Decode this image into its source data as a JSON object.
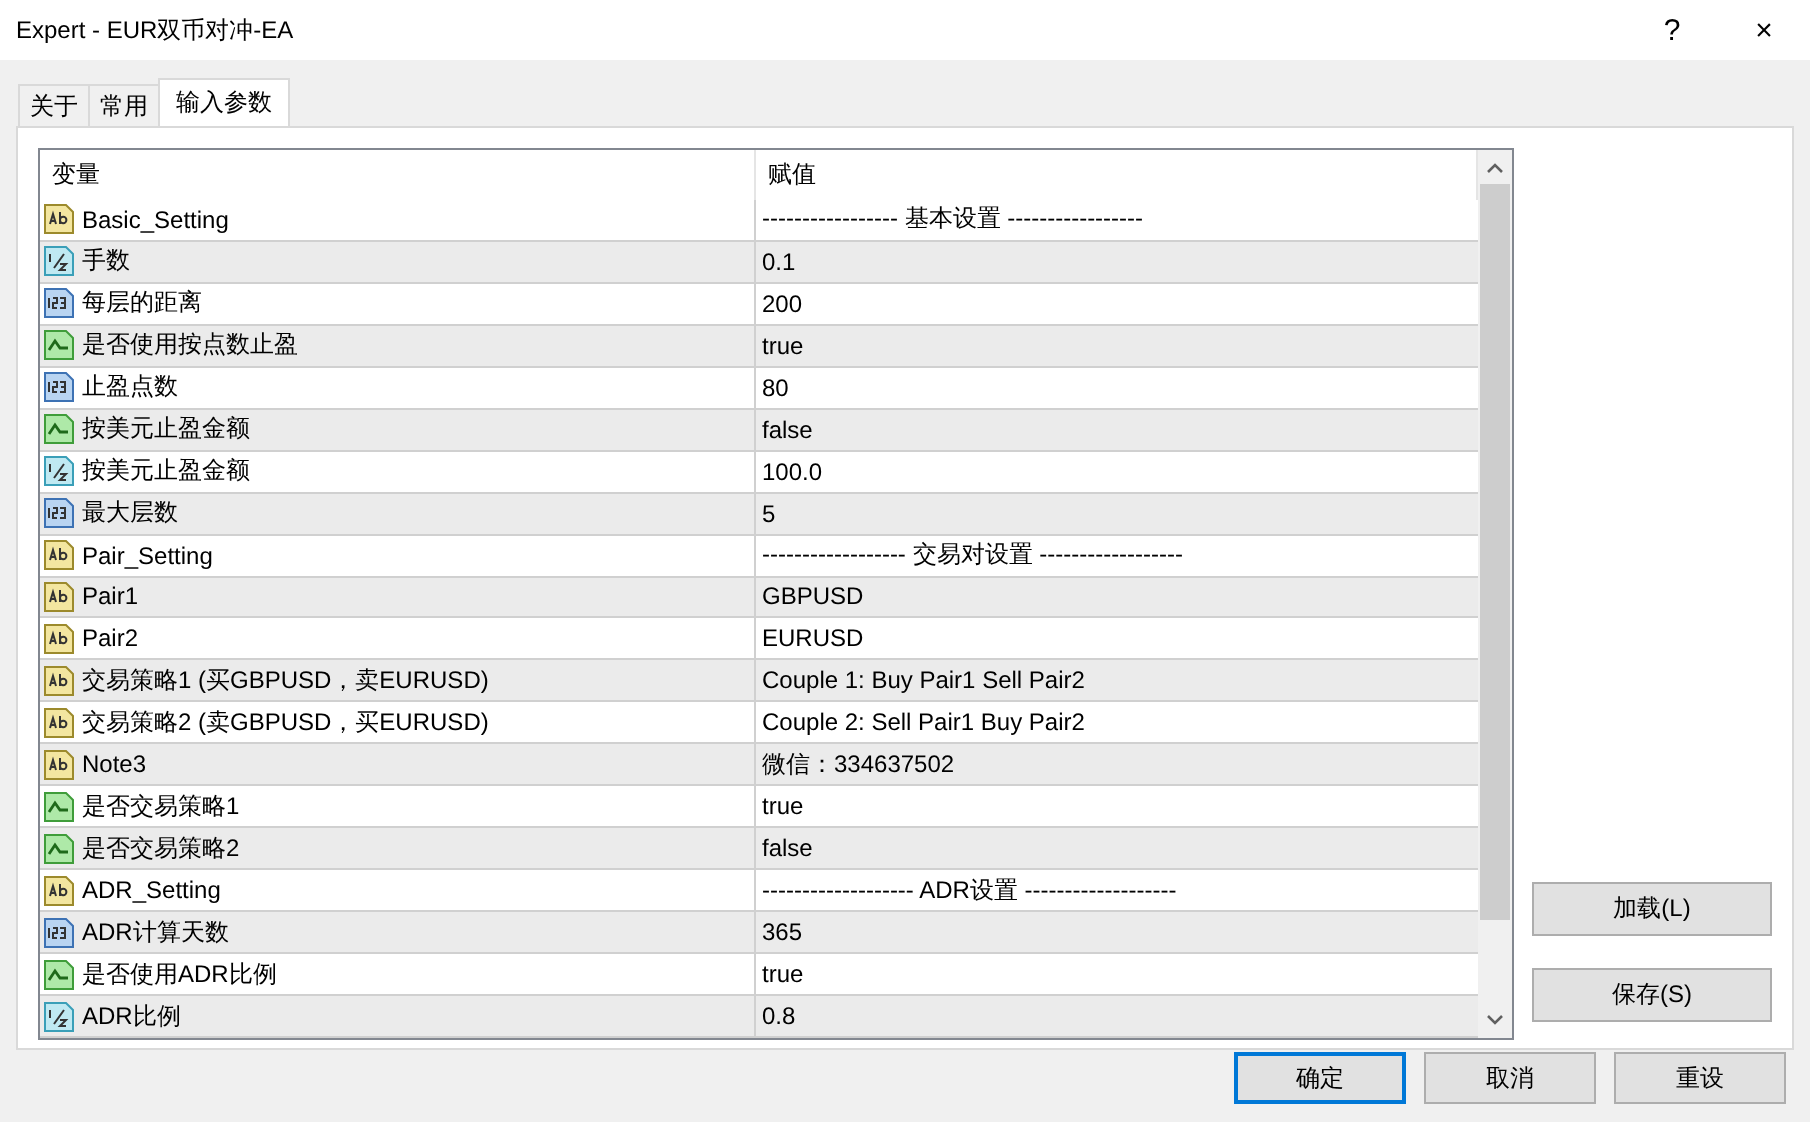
{
  "window": {
    "title": "Expert - EUR双币对冲-EA",
    "help": "?",
    "close": "×"
  },
  "tabs": [
    {
      "label": "关于",
      "selected": false
    },
    {
      "label": "常用",
      "selected": false
    },
    {
      "label": "输入参数",
      "selected": true
    }
  ],
  "table": {
    "columns": [
      "变量",
      "赋值"
    ],
    "rows": [
      {
        "kind": "string",
        "name": "Basic_Setting",
        "value": "----------------- 基本设置 -----------------"
      },
      {
        "kind": "double",
        "name": "手数",
        "value": "0.1"
      },
      {
        "kind": "int",
        "name": "每层的距离",
        "value": "200"
      },
      {
        "kind": "bool",
        "name": "是否使用按点数止盈",
        "value": "true"
      },
      {
        "kind": "int",
        "name": "止盈点数",
        "value": "80"
      },
      {
        "kind": "bool",
        "name": "按美元止盈金额",
        "value": "false"
      },
      {
        "kind": "double",
        "name": "按美元止盈金额",
        "value": "100.0"
      },
      {
        "kind": "int",
        "name": "最大层数",
        "value": "5"
      },
      {
        "kind": "string",
        "name": "Pair_Setting",
        "value": "------------------ 交易对设置 ------------------"
      },
      {
        "kind": "string",
        "name": "Pair1",
        "value": "GBPUSD"
      },
      {
        "kind": "string",
        "name": "Pair2",
        "value": "EURUSD"
      },
      {
        "kind": "string",
        "name": "交易策略1 (买GBPUSD，卖EURUSD)",
        "value": "Couple 1: Buy Pair1 Sell Pair2"
      },
      {
        "kind": "string",
        "name": "交易策略2 (卖GBPUSD，买EURUSD)",
        "value": "Couple 2: Sell Pair1 Buy Pair2"
      },
      {
        "kind": "string",
        "name": "Note3",
        "value": "微信：334637502"
      },
      {
        "kind": "bool",
        "name": "是否交易策略1",
        "value": "true"
      },
      {
        "kind": "bool",
        "name": "是否交易策略2",
        "value": "false"
      },
      {
        "kind": "string",
        "name": "ADR_Setting",
        "value": "------------------- ADR设置 -------------------"
      },
      {
        "kind": "int",
        "name": "ADR计算天数",
        "value": "365"
      },
      {
        "kind": "bool",
        "name": "是否使用ADR比例",
        "value": "true"
      },
      {
        "kind": "double",
        "name": "ADR比例",
        "value": "0.8"
      }
    ]
  },
  "side_buttons": [
    "加载(L)",
    "保存(S)"
  ],
  "buttons": [
    {
      "label": "确定",
      "selected": true
    },
    {
      "label": "取消",
      "selected": false
    },
    {
      "label": "重设",
      "selected": false
    }
  ]
}
